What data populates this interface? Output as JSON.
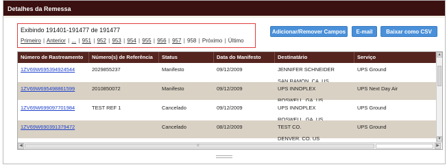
{
  "panel": {
    "title": "Detalhes da Remessa"
  },
  "pager": {
    "showing": "Exibindo 191401-191477 de 191477",
    "first": "Primeiro",
    "previous": "Anterior",
    "ellipsis": "...",
    "pages": [
      "951",
      "952",
      "953",
      "954",
      "955",
      "956",
      "957"
    ],
    "current": "958",
    "next": "Próximo",
    "last": "Último",
    "separator": "|"
  },
  "actions": {
    "toggle_fields": "Adicionar/Remover Campos",
    "email": "E-mail",
    "csv": "Baixar como CSV"
  },
  "table": {
    "headers": [
      "Número de Rastreamento",
      "Número(s) de Referência",
      "Status",
      "Data do Manifesto",
      "Destinatário",
      "Serviço"
    ],
    "rows": [
      {
        "tracking": "1ZV69W695394924544",
        "reference": "2029855237",
        "status": "Manifesto",
        "date": "09/12/2009",
        "recipient_name": "JENNIFER SCHNEIDER",
        "recipient_city": "SAN RAMON, CA, US",
        "service": "UPS Ground"
      },
      {
        "tracking": "1ZV69W695498861599",
        "reference": "2010850072",
        "status": "Manifesto",
        "date": "09/12/2009",
        "recipient_name": "UPS INNOPLEX",
        "recipient_city": "ROSWELL, GA, US",
        "service": "UPS Next Day Air"
      },
      {
        "tracking": "1ZV69W699097701984",
        "reference": "TEST REF 1",
        "status": "Cancelado",
        "date": "09/12/2009",
        "recipient_name": "UPS INNOPLEX",
        "recipient_city": "ROSWELL, GA, US",
        "service": "UPS Ground"
      },
      {
        "tracking": "1ZV69W690391379472",
        "reference": "",
        "status": "Cancelado",
        "date": "08/12/2009",
        "recipient_name": "TEST CO.",
        "recipient_city": "DENVER, CO, US",
        "service": "UPS Ground"
      }
    ]
  },
  "colors": {
    "title_bar": "#3b1010",
    "header": "#55241f",
    "button": "#4a90d9",
    "link": "#1a3fcc",
    "pager_outline": "#e23a3a",
    "alt_row": "#d9d1c4"
  },
  "icons": {
    "scroll_up": "scroll-up-arrow",
    "scroll_down": "scroll-down-arrow",
    "scroll_left": "scroll-left-arrow",
    "scroll_right": "scroll-right-arrow",
    "scroll_grip": "scroll-grip"
  }
}
